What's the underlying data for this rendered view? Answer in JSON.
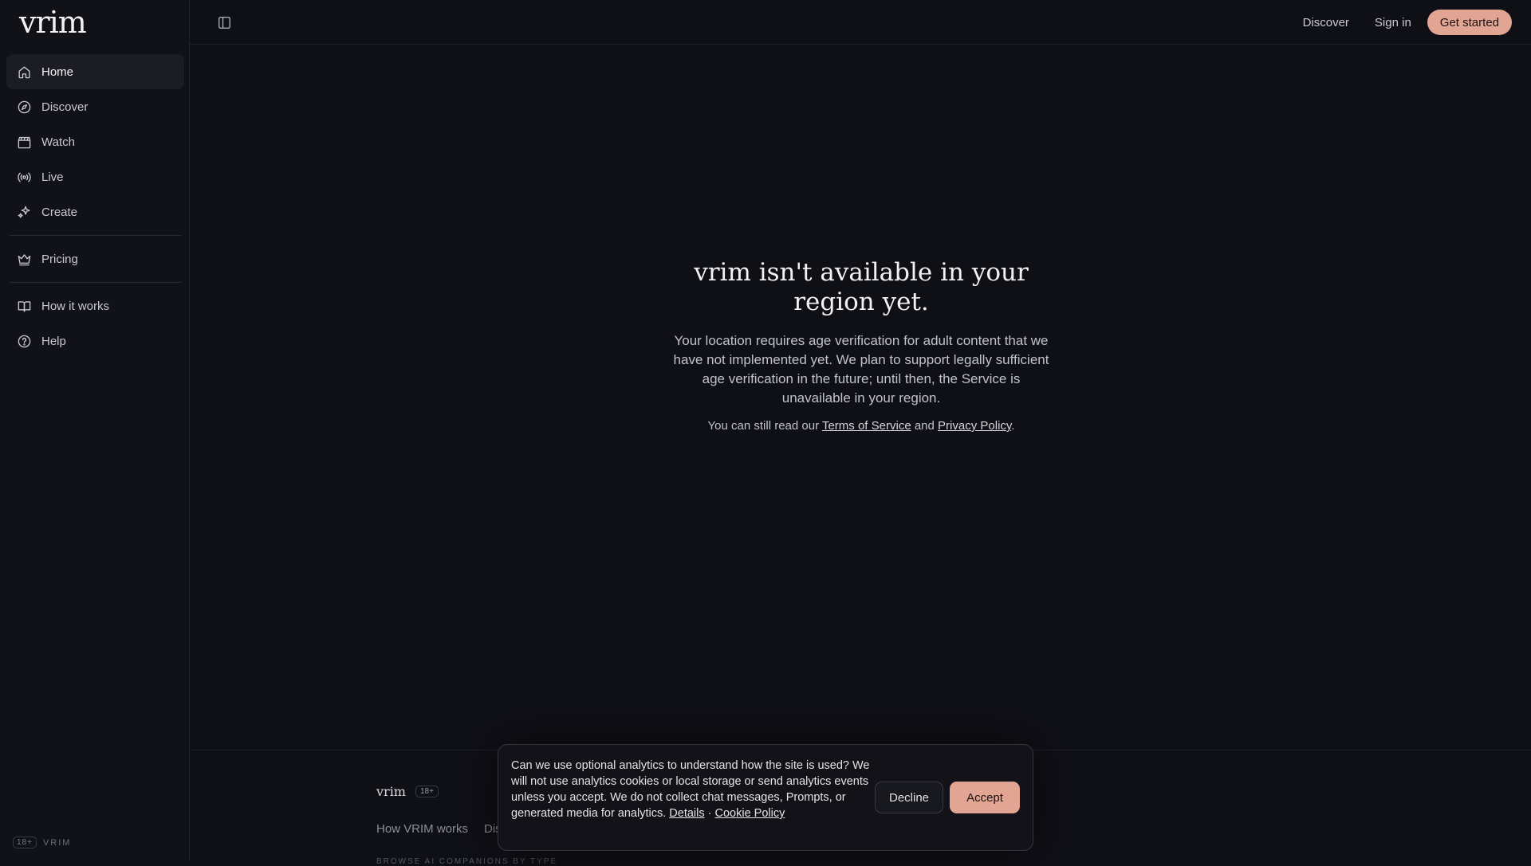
{
  "brand": {
    "logo": "vrim"
  },
  "sidebar": {
    "items": [
      {
        "label": "Home",
        "icon": "home-icon",
        "active": true
      },
      {
        "label": "Discover",
        "icon": "compass-icon"
      },
      {
        "label": "Watch",
        "icon": "clapperboard-icon"
      },
      {
        "label": "Live",
        "icon": "broadcast-icon"
      },
      {
        "label": "Create",
        "icon": "sparkles-icon"
      },
      {
        "label": "Pricing",
        "icon": "crown-icon"
      },
      {
        "label": "How it works",
        "icon": "book-icon"
      },
      {
        "label": "Help",
        "icon": "help-circle-icon"
      }
    ],
    "footer_badge": "18+",
    "footer_name": "VRIM"
  },
  "topbar": {
    "toggle_icon": "sidebar-toggle-icon",
    "discover": "Discover",
    "sign_in": "Sign in",
    "get_started": "Get started"
  },
  "main": {
    "headline": "vrim isn't available in your region yet.",
    "description": "Your location requires age verification for adult content that we have not implemented yet. We plan to support legally sufficient age verification in the future; until then, the Service is unavailable in your region.",
    "read_prefix": "You can still read our ",
    "terms_link": "Terms of Service",
    "read_and": " and ",
    "privacy_link": "Privacy Policy",
    "read_suffix": "."
  },
  "footer": {
    "brand": "vrim",
    "badge": "18+",
    "links": [
      "How VRIM works",
      "Dis"
    ],
    "caption": "BROWSE AI COMPANIONS BY TYPE"
  },
  "consent": {
    "text": "Can we use optional analytics to understand how the site is used? We will not use analytics cookies or local storage or send analytics events unless you accept. We do not collect chat messages, Prompts, or generated media for analytics. ",
    "details_link": "Details",
    "separator": " · ",
    "cookie_link": "Cookie Policy",
    "decline": "Decline",
    "accept": "Accept"
  },
  "colors": {
    "accent": "#e2a593",
    "background": "#0f0f16",
    "sidebar": "#111118"
  }
}
